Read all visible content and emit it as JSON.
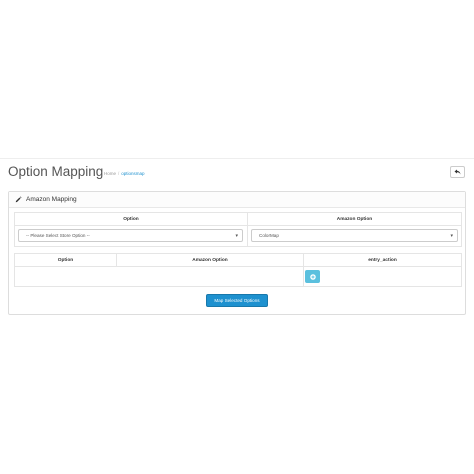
{
  "page": {
    "title": "Option Mapping",
    "breadcrumb": [
      "Home",
      "optionsmap"
    ],
    "back_icon": "reply-icon"
  },
  "panel": {
    "icon": "pencil-icon",
    "title": "Amazon Mapping"
  },
  "option_table": {
    "headers": [
      "Option",
      "Amazon Option"
    ],
    "store_option_select": "-- Please Select Store Option --",
    "amazon_option_select": "ColorMap"
  },
  "mapping_table": {
    "headers": [
      "Option",
      "Amazon Option",
      "entry_action"
    ],
    "add_icon": "plus-circle-icon"
  },
  "actions": {
    "map_button": "Map Selected Options"
  },
  "colors": {
    "primary": "#1e91cf",
    "info": "#5bc0de"
  }
}
